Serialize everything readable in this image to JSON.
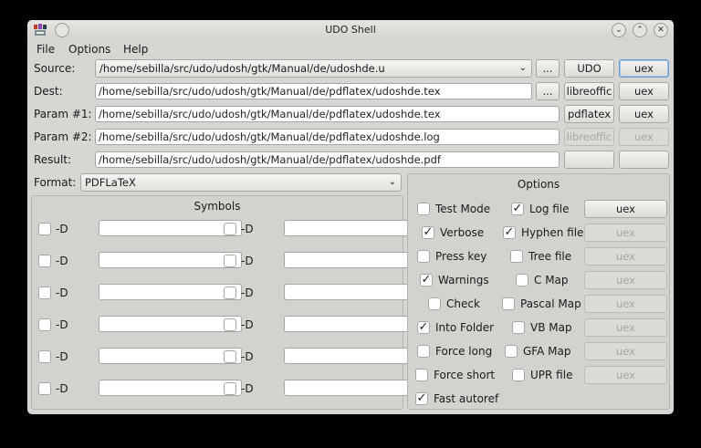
{
  "window": {
    "title": "UDO Shell"
  },
  "menu": {
    "file": "File",
    "options": "Options",
    "help": "Help"
  },
  "source": {
    "label": "Source:",
    "value": "/home/sebilla/src/udo/udosh/gtk/Manual/de/udoshde.u",
    "browse": "...",
    "btn1": "UDO",
    "btn2": "uex"
  },
  "dest": {
    "label": "Dest:",
    "value": "/home/sebilla/src/udo/udosh/gtk/Manual/de/pdflatex/udoshde.tex",
    "browse": "...",
    "btn1": "libreoffic",
    "btn2": "uex"
  },
  "param1": {
    "label": "Param #1:",
    "value": "/home/sebilla/src/udo/udosh/gtk/Manual/de/pdflatex/udoshde.tex",
    "btn1": "pdflatex",
    "btn2": "uex"
  },
  "param2": {
    "label": "Param #2:",
    "value": "/home/sebilla/src/udo/udosh/gtk/Manual/de/pdflatex/udoshde.log",
    "btn1": "libreoffic",
    "btn2": "uex"
  },
  "result": {
    "label": "Result:",
    "value": "/home/sebilla/src/udo/udosh/gtk/Manual/de/pdflatex/udoshde.pdf",
    "btn1": "",
    "btn2": ""
  },
  "format": {
    "label": "Format:",
    "value": "PDFLaTeX"
  },
  "symbols": {
    "title": "Symbols",
    "prefix": "-D",
    "rows": 6
  },
  "options": {
    "title": "Options",
    "left": [
      {
        "label": "Test Mode",
        "checked": false
      },
      {
        "label": "Verbose",
        "checked": true
      },
      {
        "label": "Press key",
        "checked": false
      },
      {
        "label": "Warnings",
        "checked": true
      },
      {
        "label": "Check",
        "checked": false
      },
      {
        "label": "Into Folder",
        "checked": true
      },
      {
        "label": "Force long",
        "checked": false
      },
      {
        "label": "Force short",
        "checked": false
      },
      {
        "label": "Fast autoref",
        "checked": true
      }
    ],
    "right": [
      {
        "label": "Log file",
        "checked": true,
        "btn": "uex",
        "enabled": true
      },
      {
        "label": "Hyphen file",
        "checked": true,
        "btn": "uex",
        "enabled": false
      },
      {
        "label": "Tree file",
        "checked": false,
        "btn": "uex",
        "enabled": false
      },
      {
        "label": "C Map",
        "checked": false,
        "btn": "uex",
        "enabled": false
      },
      {
        "label": "Pascal Map",
        "checked": false,
        "btn": "uex",
        "enabled": false
      },
      {
        "label": "VB Map",
        "checked": false,
        "btn": "uex",
        "enabled": false
      },
      {
        "label": "GFA Map",
        "checked": false,
        "btn": "uex",
        "enabled": false
      },
      {
        "label": "UPR file",
        "checked": false,
        "btn": "uex",
        "enabled": false
      }
    ]
  }
}
